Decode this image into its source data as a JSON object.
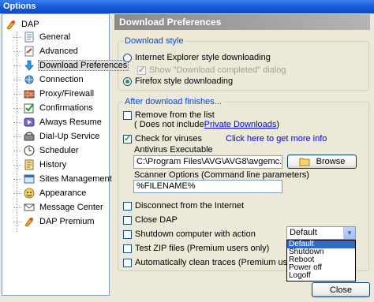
{
  "window": {
    "title": "Options"
  },
  "tree": {
    "root": {
      "label": "DAP",
      "icon": "dap-icon"
    },
    "items": [
      {
        "label": "General",
        "icon": "general-icon"
      },
      {
        "label": "Advanced",
        "icon": "advanced-icon"
      },
      {
        "label": "Download Preferences",
        "icon": "download-arrow-icon",
        "selected": true
      },
      {
        "label": "Connection",
        "icon": "connection-icon"
      },
      {
        "label": "Proxy/Firewall",
        "icon": "firewall-icon"
      },
      {
        "label": "Confirmations",
        "icon": "checkmark-icon"
      },
      {
        "label": "Always Resume",
        "icon": "resume-icon"
      },
      {
        "label": "Dial-Up Service",
        "icon": "dialup-icon"
      },
      {
        "label": "Scheduler",
        "icon": "clock-icon"
      },
      {
        "label": "History",
        "icon": "history-icon"
      },
      {
        "label": "Sites Management",
        "icon": "sites-icon"
      },
      {
        "label": "Appearance",
        "icon": "appearance-icon"
      },
      {
        "label": "Message Center",
        "icon": "message-icon"
      },
      {
        "label": "DAP Premium",
        "icon": "premium-icon"
      }
    ]
  },
  "panel": {
    "title": "Download Preferences",
    "download_style": {
      "legend": "Download style",
      "ie_label": "Internet Explorer style downloading",
      "show_completed_label": "Show \"Download completed\" dialog",
      "firefox_label": "Firefox style downloading"
    },
    "after_download": {
      "legend": "After download finishes...",
      "remove_label": "Remove from the list",
      "not_include_prefix": "( Does not include ",
      "private_downloads_link": "Private Downloads",
      "not_include_suffix": " )",
      "check_viruses_label": "Check for viruses",
      "more_info_link": "Click here to get more info",
      "antivirus_label": "Antivirus Executable",
      "antivirus_value": "C:\\Program Files\\AVG\\AVG8\\avgemc.exe",
      "browse_label": "Browse",
      "scanner_label": "Scanner Options (Command line parameters)",
      "scanner_value": "%FILENAME%",
      "disconnect_label": "Disconnect from the Internet",
      "close_dap_label": "Close DAP",
      "shutdown_label": "Shutdown computer with action",
      "test_zip_label": "Test ZIP files (Premium users only)",
      "clean_traces_label": "Automatically clean traces (Premium users only)",
      "shutdown_action": {
        "selected": "Default",
        "options": [
          "Default",
          "Shutdown",
          "Reboot",
          "Power off",
          "Logoff"
        ]
      }
    }
  },
  "footer": {
    "close_label": "Close"
  }
}
